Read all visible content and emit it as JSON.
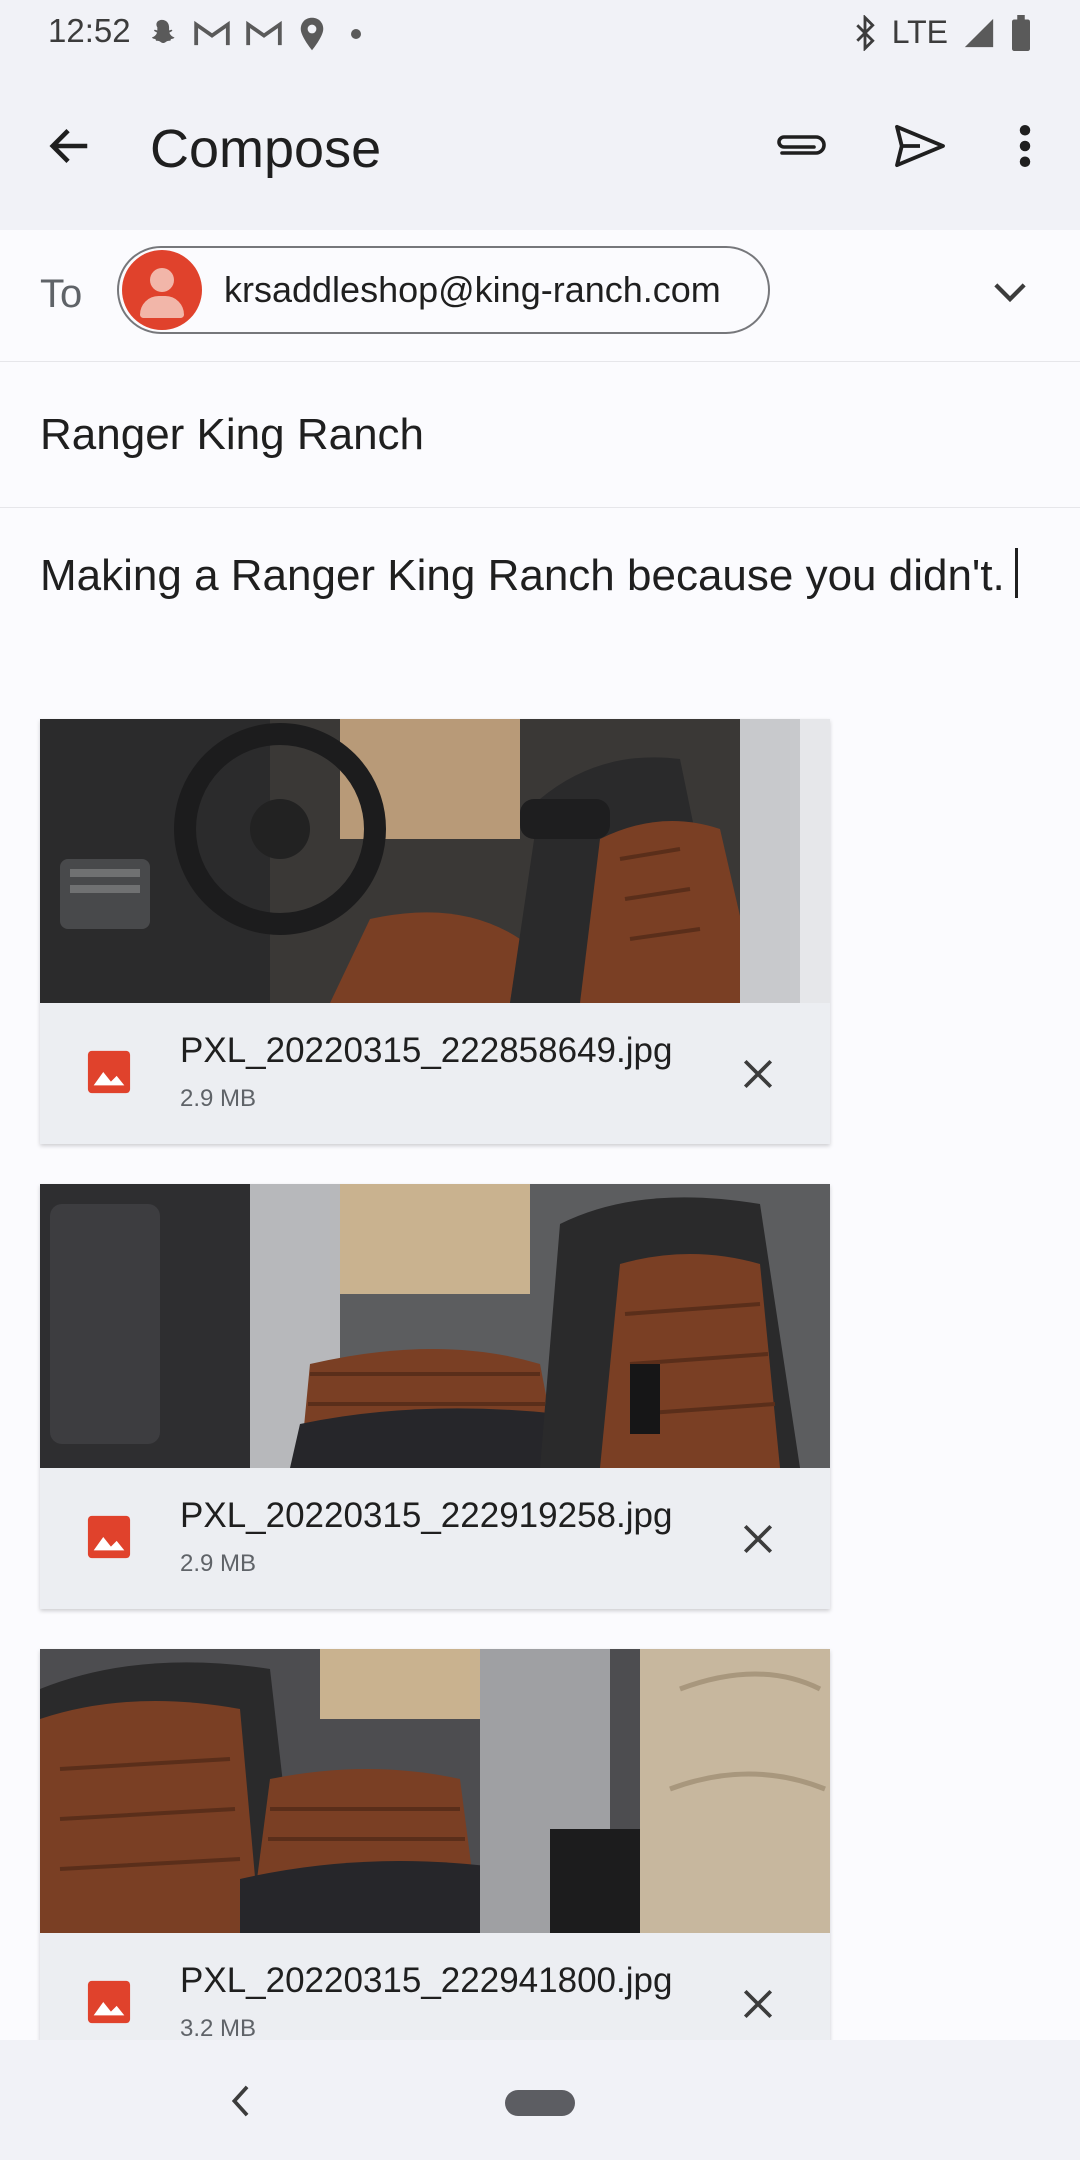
{
  "status_bar": {
    "time": "12:52",
    "left_icons": [
      "snapchat-icon",
      "gmail-icon",
      "gmail-icon",
      "location-icon",
      "dot-icon"
    ],
    "network": "LTE",
    "right_icons": [
      "bluetooth-icon",
      "signal-icon",
      "battery-icon"
    ]
  },
  "app_bar": {
    "title": "Compose",
    "back_icon": "arrow-back-icon",
    "attach_icon": "paperclip-icon",
    "send_icon": "send-icon",
    "more_icon": "more-vert-icon"
  },
  "to_field": {
    "label": "To",
    "recipient_email": "krsaddleshop@king-ranch.com",
    "avatar_color": "#e0422c",
    "expand_icon": "chevron-down-icon"
  },
  "subject": "Ranger King Ranch",
  "body": "Making a Ranger King Ranch because you didn't.",
  "attachments": [
    {
      "name": "PXL_20220315_222858649.jpg",
      "size": "2.9 MB"
    },
    {
      "name": "PXL_20220315_222919258.jpg",
      "size": "2.9 MB"
    },
    {
      "name": "PXL_20220315_222941800.jpg",
      "size": "3.2 MB"
    }
  ],
  "colors": {
    "app_bar_bg": "#f1f2f7",
    "file_icon": "#e0422c",
    "seat_leather": "#7a3f24"
  }
}
